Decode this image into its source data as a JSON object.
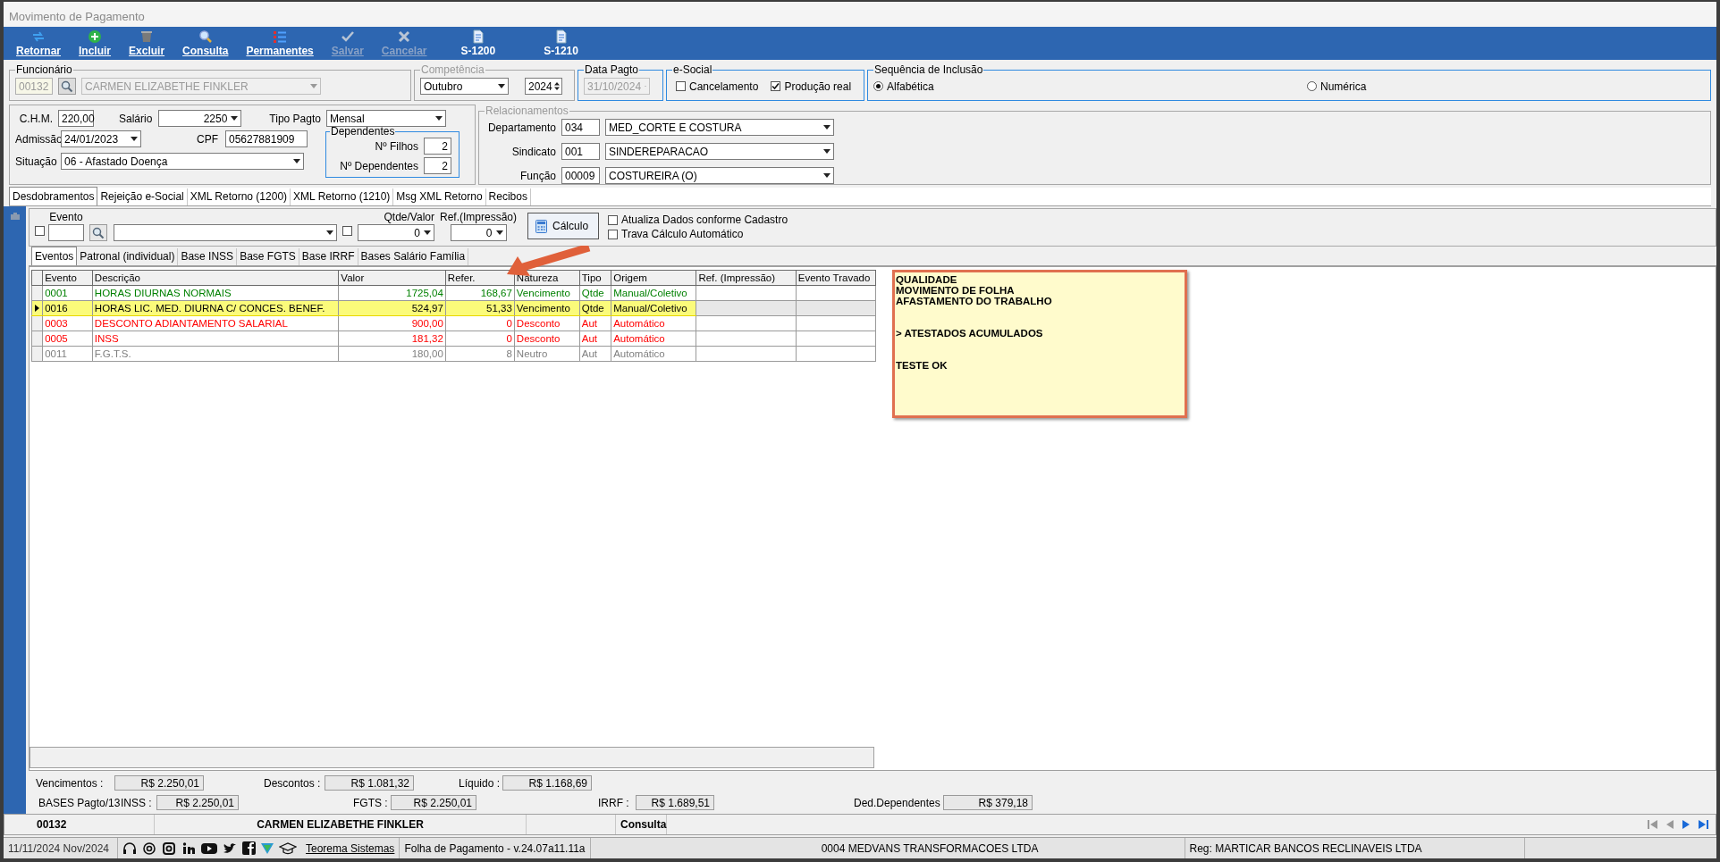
{
  "window": {
    "title": "Movimento de Pagamento"
  },
  "toolbar": [
    {
      "label": "Retornar",
      "disabled": false
    },
    {
      "label": "Incluir",
      "disabled": false
    },
    {
      "label": "Excluir",
      "disabled": false
    },
    {
      "label": "Consulta",
      "disabled": false
    },
    {
      "label": "Permanentes",
      "disabled": false
    },
    {
      "label": "Salvar",
      "disabled": true
    },
    {
      "label": "Cancelar",
      "disabled": true
    },
    {
      "label": "S-1200",
      "disabled": false
    },
    {
      "label": "S-1210",
      "disabled": false
    }
  ],
  "funcionario": {
    "legend": "Funcionário",
    "code": "00132",
    "name": "CARMEN ELIZABETHE FINKLER",
    "disabled": true
  },
  "competencia": {
    "legend": "Competência",
    "month": "Outubro",
    "year": "2024"
  },
  "data_pagto": {
    "legend": "Data Pagto",
    "value": "31/10/2024",
    "disabled": true
  },
  "esocial": {
    "legend": "e-Social",
    "options": [
      {
        "label": "Cancelamento",
        "checked": false
      },
      {
        "label": "Produção real",
        "checked": true
      }
    ]
  },
  "sequencia": {
    "legend": "Sequência de Inclusão",
    "options": [
      {
        "label": "Alfabética",
        "selected": true
      },
      {
        "label": "Numérica",
        "selected": false
      }
    ]
  },
  "dados": {
    "chm": {
      "label": "C.H.M.",
      "value": "220,00"
    },
    "salario": {
      "label": "Salário",
      "value": "2250"
    },
    "tipo_pagto": {
      "label": "Tipo Pagto",
      "value": "Mensal"
    },
    "admissao": {
      "label": "Admissão",
      "value": "24/01/2023"
    },
    "cpf": {
      "label": "CPF",
      "value": "05627881909"
    },
    "situacao": {
      "label": "Situação",
      "value": "06 - Afastado Doença"
    }
  },
  "dependentes": {
    "legend": "Dependentes",
    "rows": [
      {
        "label": "Nº Filhos",
        "value": "2"
      },
      {
        "label": "Nº Dependentes",
        "value": "2"
      }
    ]
  },
  "relacionamentos": {
    "legend": "Relacionamentos",
    "rows": [
      {
        "label": "Departamento",
        "code": "034",
        "value": "MED_CORTE E COSTURA"
      },
      {
        "label": "Sindicato",
        "code": "001",
        "value": "SINDEREPARACAO"
      },
      {
        "label": "Função",
        "code": "00009",
        "value": "COSTUREIRA (O)"
      }
    ]
  },
  "tabs": [
    {
      "label": "Desdobramentos",
      "selected": true
    },
    {
      "label": "Rejeição e-Social",
      "selected": false
    },
    {
      "label": "XML Retorno (1200)",
      "selected": false
    },
    {
      "label": "XML Retorno (1210)",
      "selected": false
    },
    {
      "label": "Msg XML Retorno",
      "selected": false
    },
    {
      "label": "Recibos",
      "selected": false
    }
  ],
  "filter": {
    "evento_label": "Evento",
    "evento_checked": false,
    "qtde_checked": false,
    "qtde_label": "Qtde/Valor",
    "qtde_value": "0",
    "ref_label": "Ref.(Impressão)",
    "ref_value": "0",
    "calc_button": "Cálculo",
    "options": [
      {
        "label": "Atualiza Dados conforme Cadastro",
        "checked": false
      },
      {
        "label": "Trava Cálculo Automático",
        "checked": false
      }
    ]
  },
  "subtabs": [
    {
      "label": "Eventos",
      "selected": true
    },
    {
      "label": "Patronal (individual)",
      "selected": false
    },
    {
      "label": "Base INSS",
      "selected": false
    },
    {
      "label": "Base FGTS",
      "selected": false
    },
    {
      "label": "Base IRRF",
      "selected": false
    },
    {
      "label": "Bases Salário Família",
      "selected": false
    }
  ],
  "table": {
    "columns": [
      "Evento",
      "Descrição",
      "Valor",
      "Refer.",
      "Natureza",
      "Tipo",
      "Origem",
      "Ref. (Impressão)",
      "Evento Travado"
    ],
    "rows": [
      {
        "cells": [
          "0001",
          "HORAS DIURNAS NORMAIS",
          "1725,04",
          "168,67",
          "Vencimento",
          "Qtde",
          "Manual/Coletivo"
        ],
        "color": "#008000",
        "selected": false,
        "highlighted": false
      },
      {
        "cells": [
          "0016",
          "HORAS LIC. MED. DIURNA C/ CONCES. BENEF.",
          "524,97",
          "51,33",
          "Vencimento",
          "Qtde",
          "Manual/Coletivo"
        ],
        "color": "#000000",
        "selected": true,
        "highlighted": true
      },
      {
        "cells": [
          "0003",
          "DESCONTO ADIANTAMENTO SALARIAL",
          "900,00",
          "0",
          "Desconto",
          "Aut",
          "Automático"
        ],
        "color": "#ff0000",
        "selected": false,
        "highlighted": false
      },
      {
        "cells": [
          "0005",
          "INSS",
          "181,32",
          "0",
          "Desconto",
          "Aut",
          "Automático"
        ],
        "color": "#ff0000",
        "selected": false,
        "highlighted": false
      },
      {
        "cells": [
          "0011",
          "F.G.T.S.",
          "180,00",
          "8",
          "Neutro",
          "Aut",
          "Automático"
        ],
        "color": "#808080",
        "selected": false,
        "highlighted": false
      }
    ]
  },
  "note": {
    "paragraphs": [
      [
        "QUALIDADE",
        "MOVIMENTO DE FOLHA",
        "AFASTAMENTO DO TRABALHO"
      ],
      [
        "> ATESTADOS ACUMULADOS"
      ],
      [
        "TESTE OK"
      ]
    ]
  },
  "totals": {
    "row1": [
      {
        "label": "Vencimentos :",
        "value": "R$ 2.250,01"
      },
      {
        "label": "Descontos :",
        "value": "R$ 1.081,32"
      },
      {
        "label": "Líquido :",
        "value": "R$ 1.168,69"
      }
    ],
    "bases_label": "BASES Pagto/13",
    "row2": [
      {
        "label": "INSS :",
        "value": "R$ 2.250,01"
      },
      {
        "label": "FGTS :",
        "value": "R$ 2.250,01"
      },
      {
        "label": "IRRF :",
        "value": "R$ 1.689,51"
      },
      {
        "label": "Ded.Dependentes",
        "value": "R$ 379,18"
      }
    ]
  },
  "record_bar": {
    "code": "00132",
    "name": "CARMEN ELIZABETHE FINKLER",
    "mode": "Consulta"
  },
  "status_bar": {
    "date": "11/11/2024 Nov/2024",
    "link": "Teorema Sistemas",
    "version": "Folha de Pagamento - v.24.07a11.11a",
    "company": "0004 MEDVANS TRANSFORMACOES LTDA",
    "reg": "Reg: MARTICAR BANCOS RECLINAVEIS LTDA"
  }
}
